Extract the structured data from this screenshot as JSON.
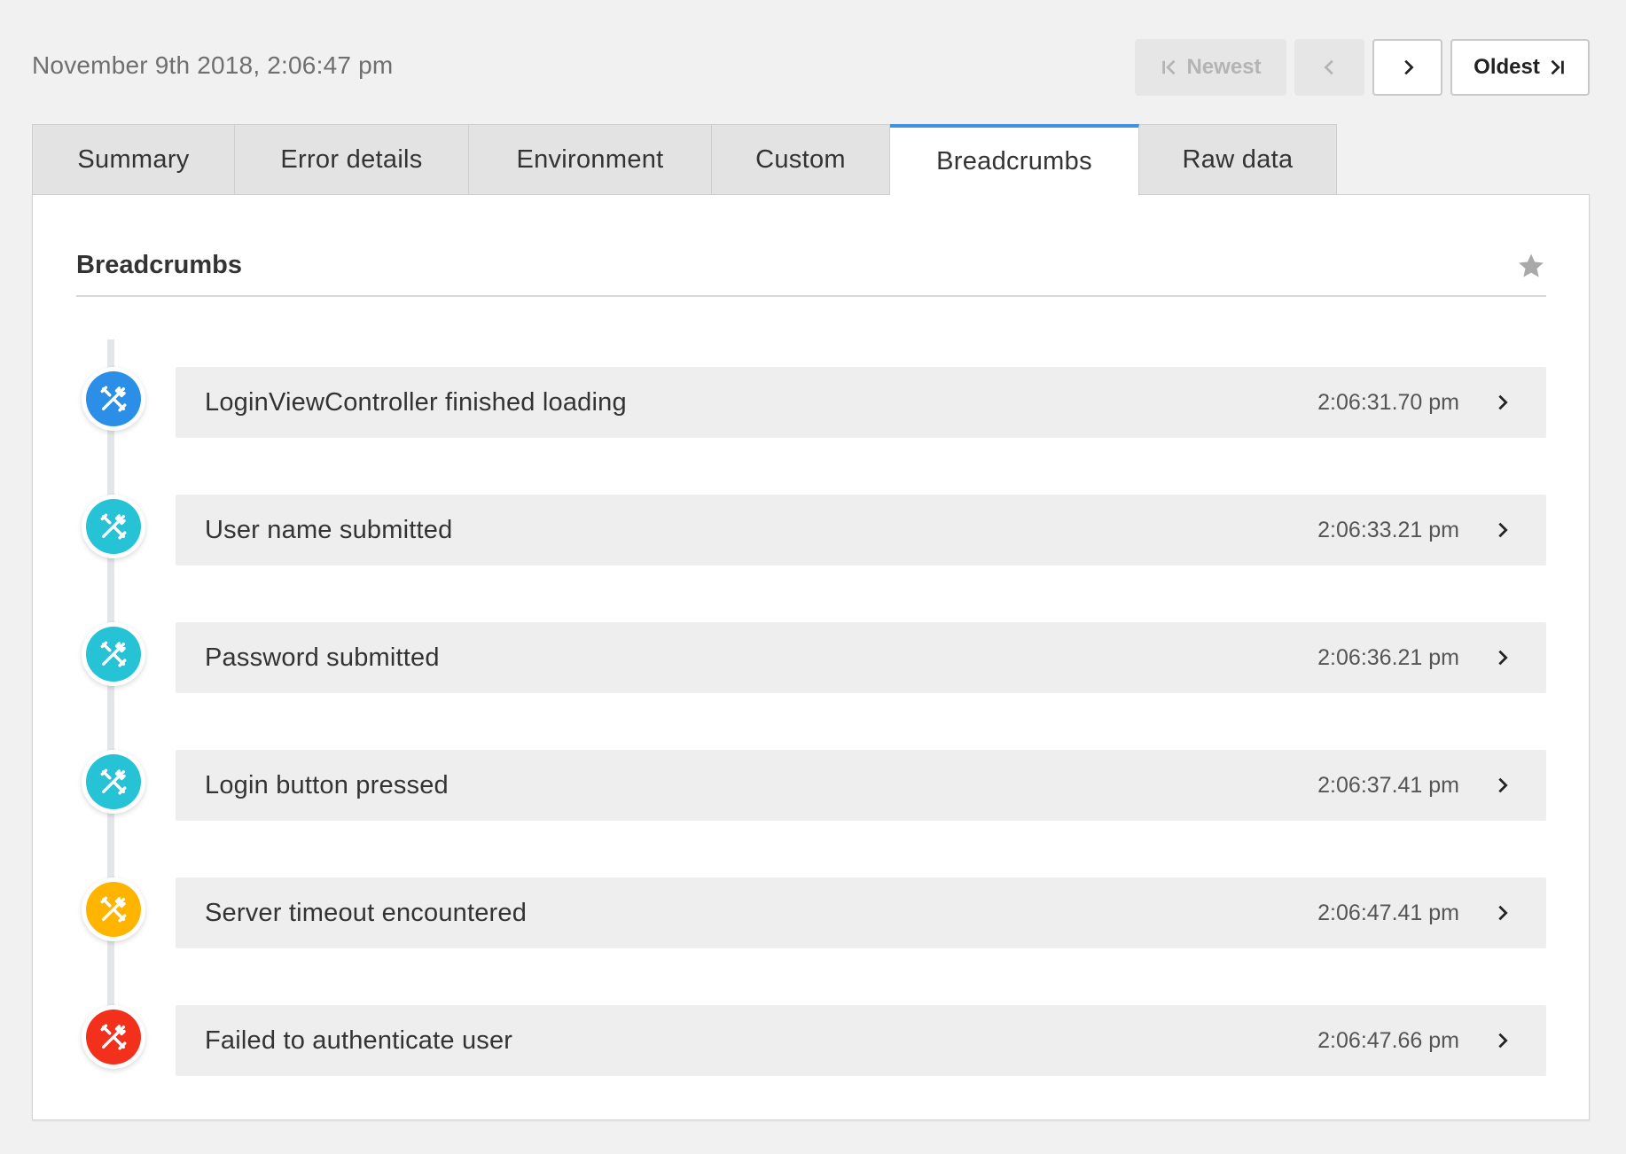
{
  "header": {
    "datetime": "November 9th 2018, 2:06:47 pm",
    "newest_label": "Newest",
    "oldest_label": "Oldest"
  },
  "tabs": [
    {
      "label": "Summary"
    },
    {
      "label": "Error details"
    },
    {
      "label": "Environment"
    },
    {
      "label": "Custom"
    },
    {
      "label": "Breadcrumbs",
      "active": true
    },
    {
      "label": "Raw data"
    }
  ],
  "panel": {
    "title": "Breadcrumbs",
    "breadcrumbs": [
      {
        "label": "LoginViewController finished loading",
        "time": "2:06:31.70 pm",
        "icon": "tools-icon",
        "color": "#2b8fe8"
      },
      {
        "label": "User name submitted",
        "time": "2:06:33.21 pm",
        "icon": "tools-icon",
        "color": "#26c2d6"
      },
      {
        "label": "Password submitted",
        "time": "2:06:36.21 pm",
        "icon": "tools-icon",
        "color": "#26c2d6"
      },
      {
        "label": "Login button pressed",
        "time": "2:06:37.41 pm",
        "icon": "tools-icon",
        "color": "#26c2d6"
      },
      {
        "label": "Server timeout encountered",
        "time": "2:06:47.41 pm",
        "icon": "tools-icon",
        "color": "#ffb400"
      },
      {
        "label": "Failed to authenticate user",
        "time": "2:06:47.66 pm",
        "icon": "tools-icon",
        "color": "#f3301b"
      }
    ]
  }
}
